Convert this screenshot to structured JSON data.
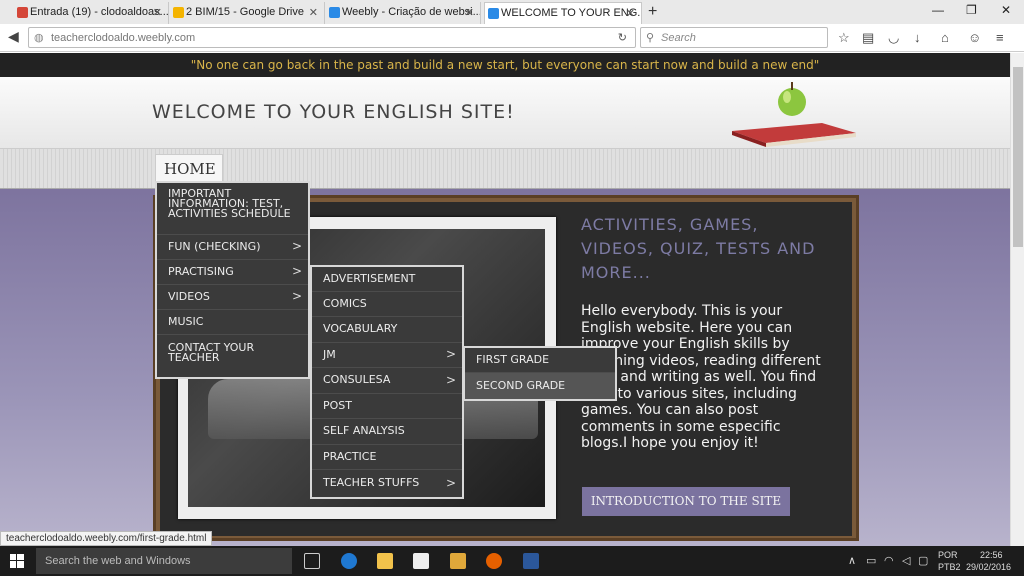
{
  "browser": {
    "tabs": [
      {
        "title": "Entrada (19) - clodoaldoas...",
        "icon": "gmail-icon",
        "color": "#d44638"
      },
      {
        "title": "2 BIM/15 - Google Drive",
        "icon": "drive-icon",
        "color": "#f4b400"
      },
      {
        "title": "Weebly - Criação de websi...",
        "icon": "weebly-icon",
        "color": "#2a8ae6"
      },
      {
        "title": "WELCOME TO YOUR ENG...",
        "icon": "weebly-icon",
        "color": "#2a8ae6"
      }
    ],
    "new_tab": "+",
    "url": "teacherclodoaldo.weebly.com",
    "search_placeholder": "Search",
    "window_controls": [
      "—",
      "❐",
      "✕"
    ]
  },
  "page": {
    "quote": "\"No one can go back in the past and build a new start, but everyone can start now and build a new end\"",
    "site_title": "WELCOME TO YOUR ENGLISH SITE!",
    "nav_home": "HOME",
    "board_heading": "ACTIVITIES, GAMES, VIDEOS, QUIZ, TESTS AND MORE...",
    "board_text": "Hello everybody. This is your English website. Here you can improve your English skills by watching videos, reading different texts and writing as well. You find links to various sites, including games. You can also post comments in some especific blogs.I hope you enjoy it!",
    "intro_button": "INTRODUCTION TO THE SITE"
  },
  "menus": {
    "home_submenu": [
      {
        "label": "IMPORTANT INFORMATION: TEST, ACTIVITIES SCHEDULE",
        "arrow": ""
      },
      {
        "label": "FUN (CHECKING)",
        "arrow": ">"
      },
      {
        "label": "PRACTISING",
        "arrow": ">"
      },
      {
        "label": "VIDEOS",
        "arrow": ">"
      },
      {
        "label": "MUSIC",
        "arrow": ""
      },
      {
        "label": "CONTACT YOUR TEACHER",
        "arrow": ""
      }
    ],
    "practising_submenu": [
      {
        "label": "ADVERTISEMENT",
        "arrow": ""
      },
      {
        "label": "COMICS",
        "arrow": ""
      },
      {
        "label": "VOCABULARY",
        "arrow": ""
      },
      {
        "label": "JM",
        "arrow": ">"
      },
      {
        "label": "CONSULESA",
        "arrow": ">"
      },
      {
        "label": "POST",
        "arrow": ""
      },
      {
        "label": "SELF ANALYSIS",
        "arrow": ""
      },
      {
        "label": "PRACTICE",
        "arrow": ""
      },
      {
        "label": "TEACHER STUFFS",
        "arrow": ">"
      }
    ],
    "jm_submenu": [
      {
        "label": "FIRST GRADE",
        "arrow": ""
      },
      {
        "label": "SECOND GRADE",
        "arrow": ""
      }
    ]
  },
  "status_url": "teacherclodoaldo.weebly.com/first-grade.html",
  "taskbar": {
    "search_placeholder": "Search the web and Windows",
    "language": "POR",
    "layout": "PTB2",
    "time": "22:56",
    "date": "29/02/2016"
  }
}
